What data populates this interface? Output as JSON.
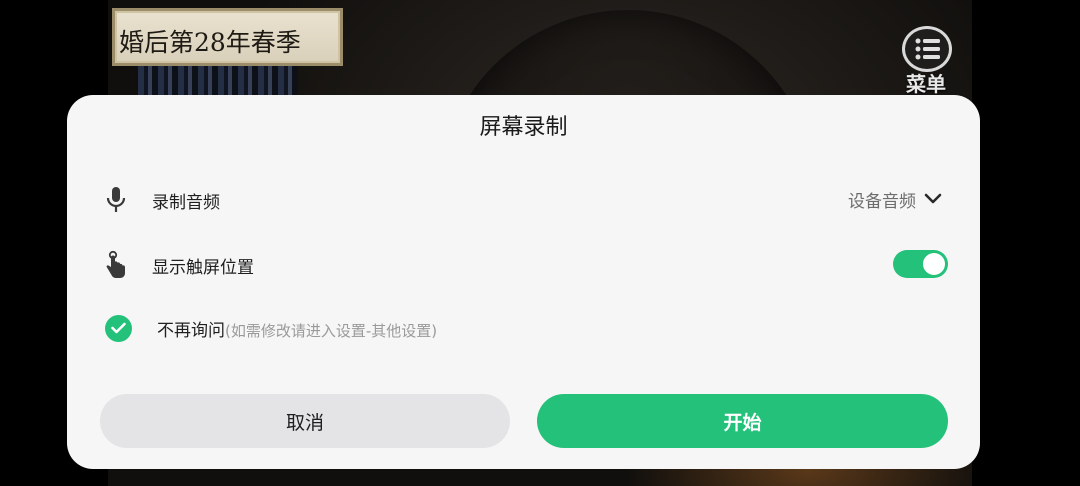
{
  "game": {
    "chapter_title": "婚后第28年春季",
    "menu_label": "菜单"
  },
  "dialog": {
    "title": "屏幕录制",
    "record_audio": {
      "label": "录制音频",
      "icon": "microphone-icon",
      "selected_value": "设备音频"
    },
    "show_touches": {
      "label": "显示触屏位置",
      "icon": "touch-hand-icon",
      "enabled": true
    },
    "dont_ask": {
      "label": "不再询问",
      "hint": "(如需修改请进入设置-其他设置)",
      "checked": true
    },
    "cancel_label": "取消",
    "start_label": "开始"
  },
  "colors": {
    "accent": "#24c17a",
    "dialog_bg": "#f6f6f6",
    "cancel_bg": "#e4e4e6"
  }
}
